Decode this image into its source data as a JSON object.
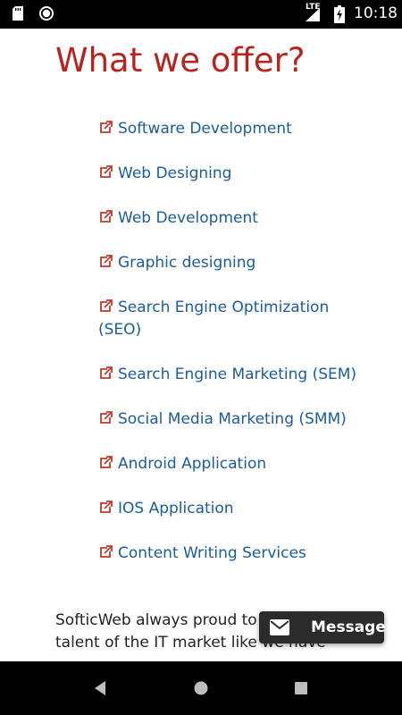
{
  "status_bar": {
    "time": "10:18",
    "network_label": "LTE",
    "icons": [
      "sd-card-icon",
      "circle-icon",
      "signal-icon",
      "battery-charging-icon"
    ]
  },
  "page": {
    "title": "What we offer?",
    "services": [
      "Software Development",
      "Web Designing",
      "Web Development",
      "Graphic designing",
      "Search Engine Optimization (SEO)",
      "Search Engine Marketing (SEM)",
      "Social Media Marketing (SMM)",
      "Android Application",
      "IOS Application",
      "Content Writing Services"
    ],
    "intro_text": "SofticWeb always proud to have the best talent of the IT market like we have"
  },
  "message_button": {
    "label": "Message",
    "icon": "mail-icon"
  },
  "nav_bar": {
    "buttons": [
      "back-icon",
      "home-icon",
      "recents-icon"
    ]
  },
  "colors": {
    "title": "#b8231f",
    "link": "#1a5c9e",
    "icon": "#c0392b",
    "status_bar": "#000000",
    "nav_bar": "#000000",
    "message_button": "#2b2b2b"
  }
}
